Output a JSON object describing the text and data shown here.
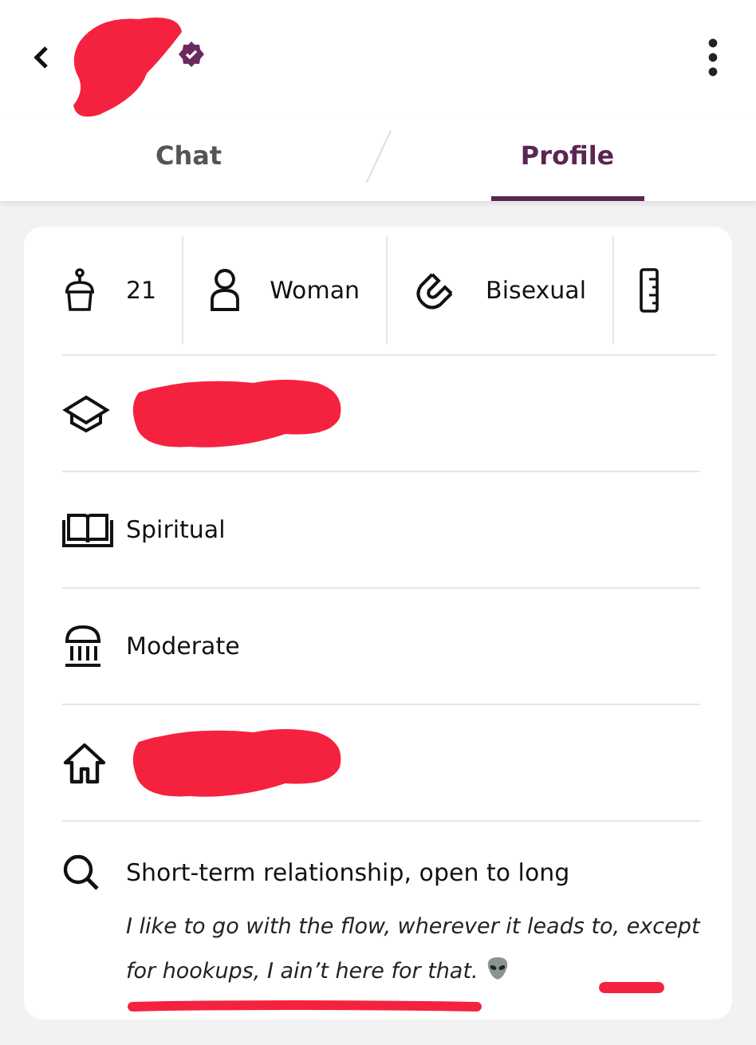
{
  "header": {
    "name_redacted": true,
    "verified": true
  },
  "tabs": [
    {
      "label": "Chat",
      "selected": false
    },
    {
      "label": "Profile",
      "selected": true
    }
  ],
  "stats": [
    {
      "kind": "age",
      "value": "21"
    },
    {
      "kind": "gender",
      "value": "Woman"
    },
    {
      "kind": "orientation",
      "value": "Bisexual"
    },
    {
      "kind": "height"
    }
  ],
  "rows": [
    {
      "kind": "education",
      "redacted": true
    },
    {
      "kind": "religion",
      "value": "Spiritual"
    },
    {
      "kind": "politics",
      "value": "Moderate"
    },
    {
      "kind": "hometown",
      "redacted": true
    },
    {
      "kind": "looking_for",
      "value": "Short-term relationship, open to long",
      "note": "I like to go with the flow, wherever it leads to, except for hookups, I ain’t here for that.",
      "note_emoji": true,
      "note_redacted": true
    }
  ]
}
